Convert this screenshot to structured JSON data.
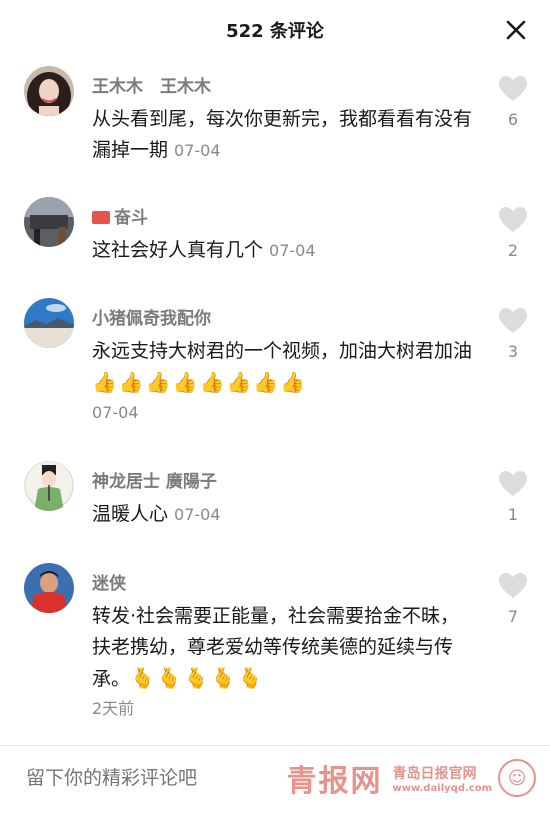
{
  "header": {
    "title": "522 条评论"
  },
  "comments": [
    {
      "username": "王木木　王木木",
      "text": "从头看到尾，每次你更新完，我都看看有没有漏掉一期",
      "date": "07-04",
      "likes": "6"
    },
    {
      "username": "奋斗",
      "text": "这社会好人真有几个",
      "date": "07-04",
      "likes": "2"
    },
    {
      "username": "小猪佩奇我配你",
      "text": "永远支持大树君的一个视频，加油大树君加油",
      "emoji": "👍👍👍👍👍👍👍👍",
      "date": "07-04",
      "likes": "3"
    },
    {
      "username": "神龙居士 廣陽子",
      "text": "温暖人心",
      "date": "07-04",
      "likes": "1"
    },
    {
      "username": "迷侠",
      "text": "转发·社会需要正能量，社会需要拾金不昧，扶老携幼，尊老爱幼等传统美德的延续与传承。",
      "emoji": "🫰🫰🫰🫰🫰",
      "date": "2天前",
      "likes": "7"
    }
  ],
  "footer": {
    "placeholder": "留下你的精彩评论吧",
    "watermark_main": "青报网",
    "watermark_sub": "青岛日报官网",
    "watermark_url": "www.dailyqd.com"
  },
  "icons": {
    "close": "close-icon",
    "like": "heart-icon",
    "flag": "flag-icon"
  }
}
